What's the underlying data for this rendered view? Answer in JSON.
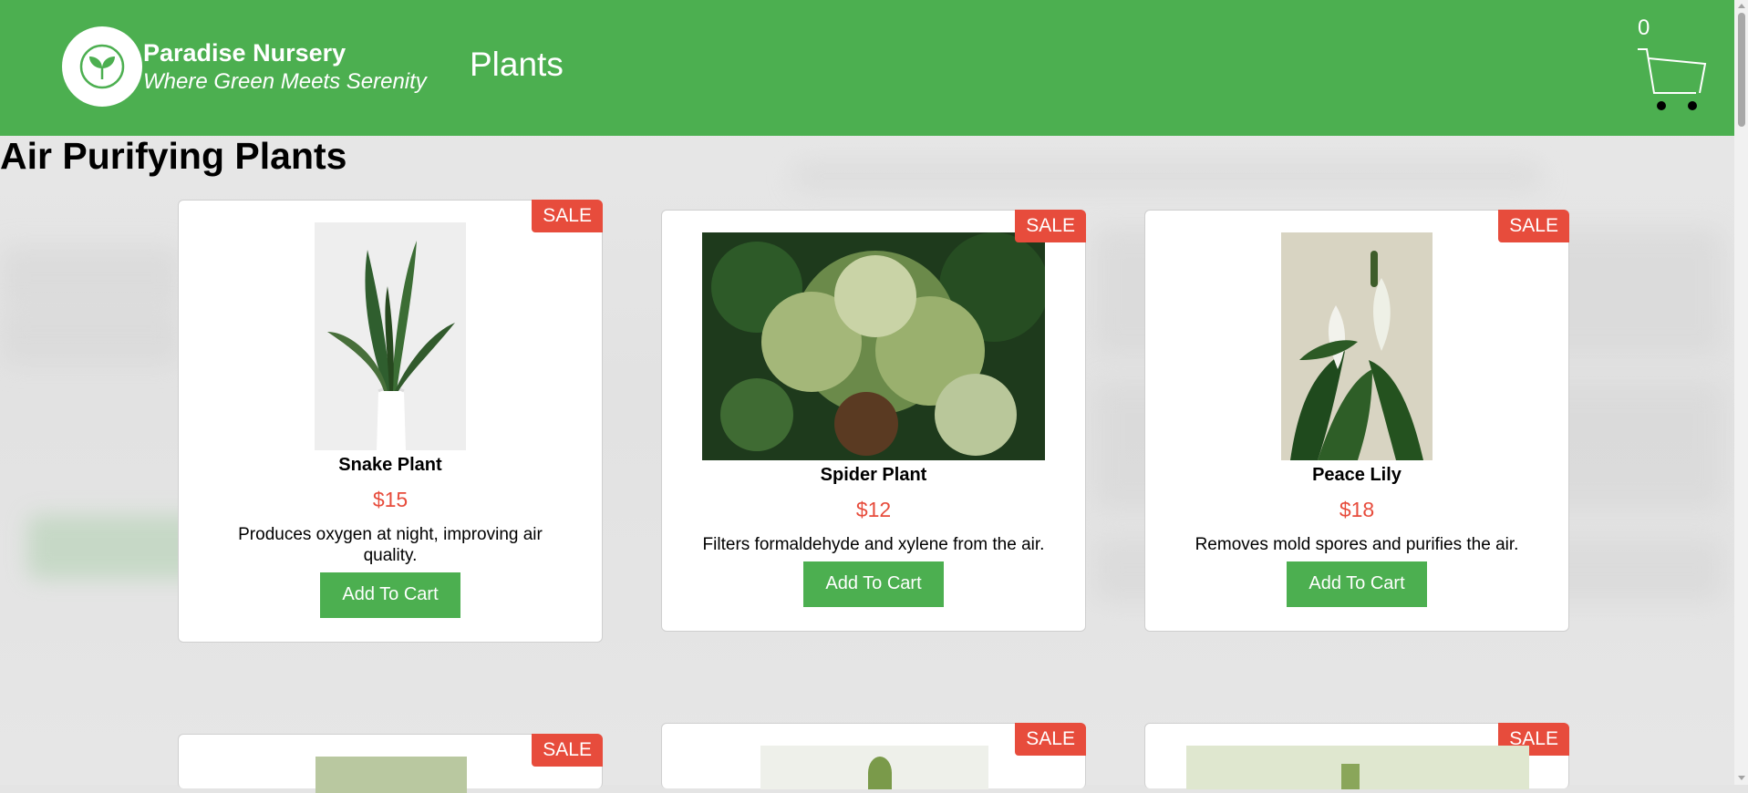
{
  "header": {
    "brand_name": "Paradise Nursery",
    "tagline": "Where Green Meets Serenity",
    "nav_link": "Plants",
    "cart_count": "0"
  },
  "section": {
    "title": "Air Purifying Plants"
  },
  "products": [
    {
      "name": "Snake Plant",
      "price": "$15",
      "description": "Produces oxygen at night, improving air quality.",
      "badge": "SALE",
      "button": "Add To Cart"
    },
    {
      "name": "Spider Plant",
      "price": "$12",
      "description": "Filters formaldehyde and xylene from the air.",
      "badge": "SALE",
      "button": "Add To Cart"
    },
    {
      "name": "Peace Lily",
      "price": "$18",
      "description": "Removes mold spores and purifies the air.",
      "badge": "SALE",
      "button": "Add To Cart"
    },
    {
      "badge": "SALE"
    },
    {
      "badge": "SALE"
    },
    {
      "badge": "SALE"
    }
  ],
  "colors": {
    "header": "#4caf50",
    "sale": "#e74c3c",
    "price": "#e74c3c",
    "button": "#4caf50"
  }
}
